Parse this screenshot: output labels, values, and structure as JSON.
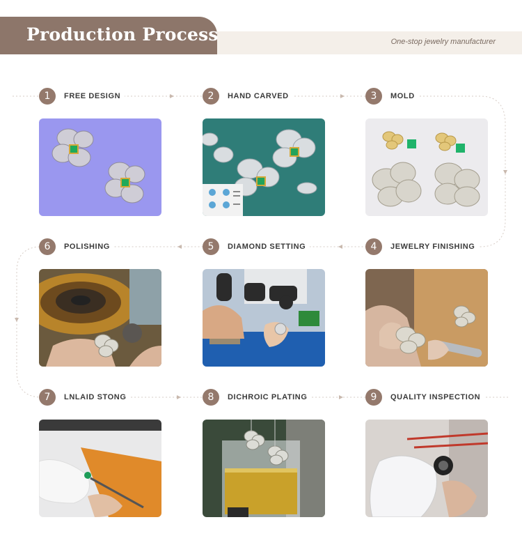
{
  "header": {
    "title": "Production Process",
    "subtitle": "One-stop jewelry manufacturer"
  },
  "colors": {
    "accent": "#8d766a",
    "band": "#f4efe9",
    "number_badge": "#94796c",
    "flow_line": "#d6cbc4"
  },
  "steps": [
    {
      "number": "1",
      "label": "FREE DESIGN",
      "image": "3d-render-flower-earrings"
    },
    {
      "number": "2",
      "label": "HAND CARVED",
      "image": "cad-render-silver-flowers"
    },
    {
      "number": "3",
      "label": "MOLD",
      "image": "wax-mold-earrings-with-emeralds"
    },
    {
      "number": "4",
      "label": "JEWELRY FINISHING",
      "image": "filing-earring-at-bench"
    },
    {
      "number": "5",
      "label": "DIAMOND SETTING",
      "image": "setting-under-microscope"
    },
    {
      "number": "6",
      "label": "POLISHING",
      "image": "polishing-wheel"
    },
    {
      "number": "7",
      "label": "LNLAID STONG",
      "image": "inlaying-stone-with-tweezers"
    },
    {
      "number": "8",
      "label": "DICHROIC PLATING",
      "image": "plating-beaker"
    },
    {
      "number": "9",
      "label": "QUALITY INSPECTION",
      "image": "inspection-with-loupe"
    }
  ]
}
